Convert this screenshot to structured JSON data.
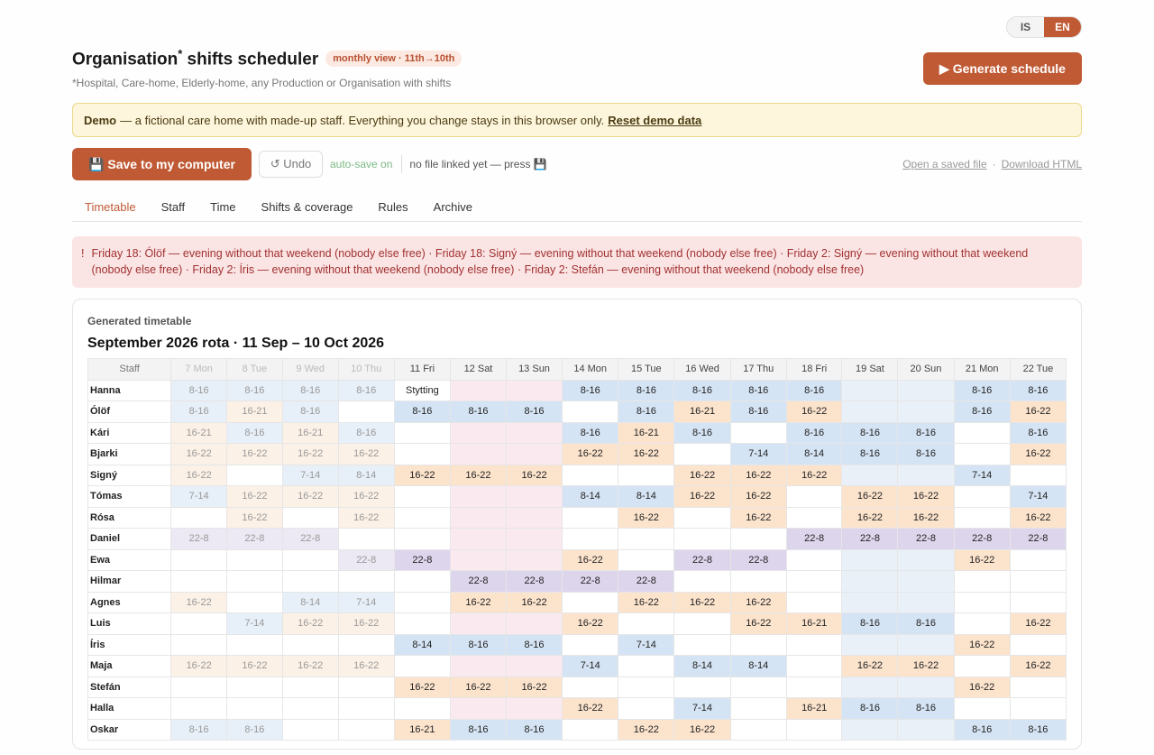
{
  "lang": {
    "is": "IS",
    "en": "EN"
  },
  "header": {
    "title": "Organisation",
    "title_sup": "*",
    "title_rest": " shifts scheduler",
    "pill": "monthly view · 11th→10th",
    "subtitle": "*Hospital, Care-home, Elderly-home, any Production or Organisation with shifts"
  },
  "generate_label": "▶ Generate schedule",
  "demo": {
    "bold": "Demo",
    "text": "— a fictional care home with made-up staff. Everything you change stays in this browser only.",
    "reset": "Reset demo data"
  },
  "toolbar": {
    "save_label": "💾 Save to my computer",
    "undo_label": "↺ Undo",
    "autosave": "auto-save on",
    "nofile": "no file linked yet — press 💾",
    "open_link": "Open a saved file",
    "sep": "·",
    "download_link": "Download HTML"
  },
  "tabs": [
    "Timetable",
    "Staff",
    "Time",
    "Shifts & coverage",
    "Rules",
    "Archive"
  ],
  "warning": {
    "icon": "!",
    "text": "Friday 18: Ólöf — evening without that weekend (nobody else free) · Friday 18: Signý — evening without that weekend (nobody else free) · Friday 2: Signý — evening without that weekend (nobody else free) · Friday 2: Íris — evening without that weekend (nobody else free) · Friday 2: Stefán — evening without that weekend (nobody else free)"
  },
  "card": {
    "label": "Generated timetable",
    "rota_title": "September 2026 rota · 11 Sep – 10 Oct 2026",
    "staff_header": "Staff",
    "days": [
      "7 Mon",
      "8 Tue",
      "9 Wed",
      "10 Thu",
      "11 Fri",
      "12 Sat",
      "13 Sun",
      "14 Mon",
      "15 Tue",
      "16 Wed",
      "17 Thu",
      "18 Fri",
      "19 Sat",
      "20 Sun",
      "21 Mon",
      "22 Tue"
    ],
    "past_days": 4,
    "weekend_a": [
      5,
      6
    ],
    "weekend_b": [
      12,
      13
    ],
    "rows": [
      {
        "name": "Hanna",
        "cells": [
          "8-16",
          "8-16",
          "8-16",
          "8-16",
          "Stytting",
          "",
          "",
          "8-16",
          "8-16",
          "8-16",
          "8-16",
          "8-16",
          "",
          "",
          "8-16",
          "8-16"
        ]
      },
      {
        "name": "Ólöf",
        "cells": [
          "8-16",
          "16-21",
          "8-16",
          "",
          "8-16",
          "8-16",
          "8-16",
          "",
          "8-16",
          "16-21",
          "8-16",
          "16-22",
          "",
          "",
          "8-16",
          "16-22"
        ]
      },
      {
        "name": "Kári",
        "cells": [
          "16-21",
          "8-16",
          "16-21",
          "8-16",
          "",
          "",
          "",
          "8-16",
          "16-21",
          "8-16",
          "",
          "8-16",
          "8-16",
          "8-16",
          "",
          "8-16"
        ]
      },
      {
        "name": "Bjarki",
        "cells": [
          "16-22",
          "16-22",
          "16-22",
          "16-22",
          "",
          "",
          "",
          "16-22",
          "16-22",
          "",
          "7-14",
          "8-14",
          "8-16",
          "8-16",
          "",
          "16-22"
        ]
      },
      {
        "name": "Signý",
        "cells": [
          "16-22",
          "",
          "7-14",
          "8-14",
          "16-22",
          "16-22",
          "16-22",
          "",
          "",
          "16-22",
          "16-22",
          "16-22",
          "",
          "",
          "7-14",
          ""
        ]
      },
      {
        "name": "Tómas",
        "cells": [
          "7-14",
          "16-22",
          "16-22",
          "16-22",
          "",
          "",
          "",
          "8-14",
          "8-14",
          "16-22",
          "16-22",
          "",
          "16-22",
          "16-22",
          "",
          "7-14"
        ]
      },
      {
        "name": "Rósa",
        "cells": [
          "",
          "16-22",
          "",
          "16-22",
          "",
          "",
          "",
          "",
          "16-22",
          "",
          "16-22",
          "",
          "16-22",
          "16-22",
          "",
          "16-22"
        ]
      },
      {
        "name": "Daniel",
        "cells": [
          "22-8",
          "22-8",
          "22-8",
          "",
          "",
          "",
          "",
          "",
          "",
          "",
          "",
          "22-8",
          "22-8",
          "22-8",
          "22-8",
          "22-8"
        ]
      },
      {
        "name": "Ewa",
        "cells": [
          "",
          "",
          "",
          "22-8",
          "22-8",
          "",
          "",
          "16-22",
          "",
          "22-8",
          "22-8",
          "",
          "",
          "",
          "16-22",
          ""
        ]
      },
      {
        "name": "Hilmar",
        "cells": [
          "",
          "",
          "",
          "",
          "",
          "22-8",
          "22-8",
          "22-8",
          "22-8",
          "",
          "",
          "",
          "",
          "",
          "",
          ""
        ]
      },
      {
        "name": "Agnes",
        "cells": [
          "16-22",
          "",
          "8-14",
          "7-14",
          "",
          "16-22",
          "16-22",
          "",
          "16-22",
          "16-22",
          "16-22",
          "",
          "",
          "",
          "",
          ""
        ]
      },
      {
        "name": "Luis",
        "cells": [
          "",
          "7-14",
          "16-22",
          "16-22",
          "",
          "",
          "",
          "16-22",
          "",
          "",
          "16-22",
          "16-21",
          "8-16",
          "8-16",
          "",
          "16-22"
        ]
      },
      {
        "name": "Íris",
        "cells": [
          "",
          "",
          "",
          "",
          "8-14",
          "8-16",
          "8-16",
          "",
          "7-14",
          "",
          "",
          "",
          "",
          "",
          "16-22",
          ""
        ]
      },
      {
        "name": "Maja",
        "cells": [
          "16-22",
          "16-22",
          "16-22",
          "16-22",
          "",
          "",
          "",
          "7-14",
          "",
          "8-14",
          "8-14",
          "",
          "16-22",
          "16-22",
          "",
          "16-22"
        ]
      },
      {
        "name": "Stefán",
        "cells": [
          "",
          "",
          "",
          "",
          "16-22",
          "16-22",
          "16-22",
          "",
          "",
          "",
          "",
          "",
          "",
          "",
          "16-22",
          ""
        ]
      },
      {
        "name": "Halla",
        "cells": [
          "",
          "",
          "",
          "",
          "",
          "",
          "",
          "16-22",
          "",
          "7-14",
          "",
          "16-21",
          "8-16",
          "8-16",
          "",
          ""
        ]
      },
      {
        "name": "Oskar",
        "cells": [
          "8-16",
          "8-16",
          "",
          "",
          "16-21",
          "8-16",
          "8-16",
          "",
          "16-22",
          "16-22",
          "",
          "",
          "",
          "",
          "8-16",
          "8-16"
        ]
      }
    ]
  },
  "colors": {
    "accent": "#c05a35",
    "day": "#d5e4f4",
    "evening": "#fbe3cc",
    "night": "#ddd5ec",
    "warning_bg": "#fbe4e4",
    "demo_bg": "#fdf5dc"
  }
}
